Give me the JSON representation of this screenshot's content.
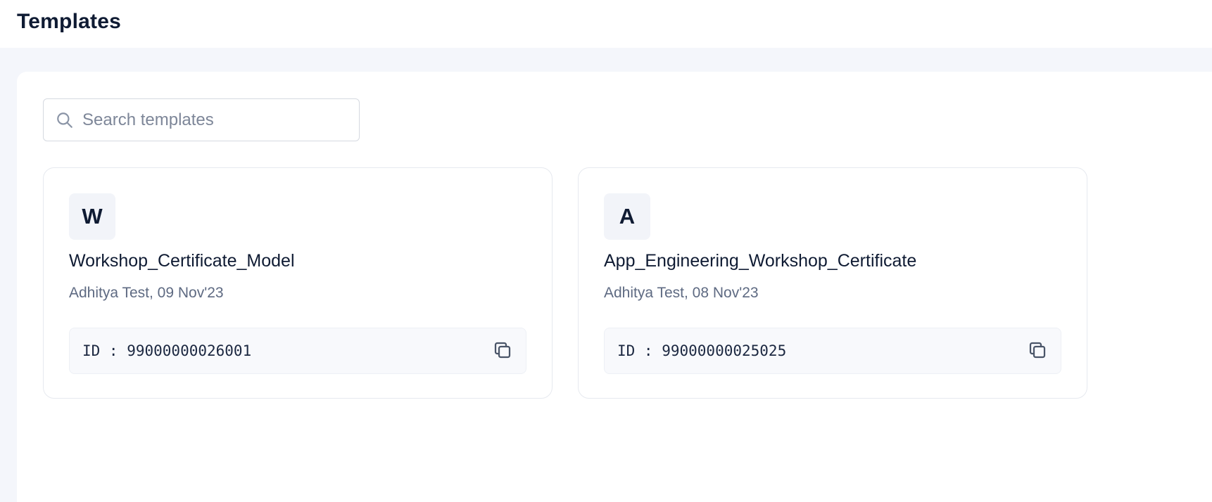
{
  "header": {
    "title": "Templates"
  },
  "search": {
    "placeholder": "Search templates",
    "value": "",
    "icon": "search-icon"
  },
  "templates": [
    {
      "initial": "W",
      "name": "Workshop_Certificate_Model",
      "meta": "Adhitya Test, 09 Nov'23",
      "id_text": "ID : 99000000026001",
      "copy_icon": "copy-icon"
    },
    {
      "initial": "A",
      "name": "App_Engineering_Workshop_Certificate",
      "meta": "Adhitya Test, 08 Nov'23",
      "id_text": "ID : 99000000025025",
      "copy_icon": "copy-icon"
    }
  ],
  "colors": {
    "text_primary": "#0f1b33",
    "text_secondary": "#5e6a82",
    "page_background": "#f4f6fb",
    "avatar_background": "#f2f4f9",
    "border": "#e6e9ef"
  }
}
